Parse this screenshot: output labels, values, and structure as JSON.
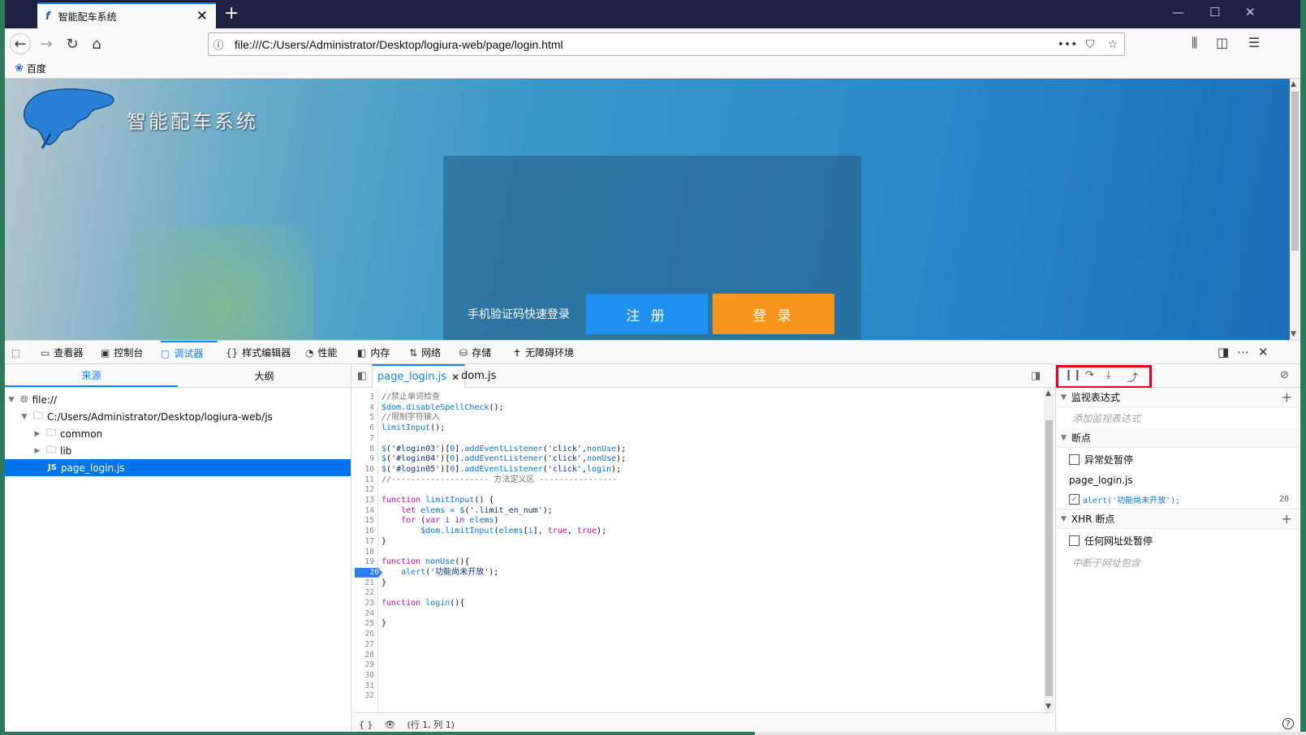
{
  "browser": {
    "tab_title": "智能配车系统",
    "tab_favicon": "f",
    "url": "file:///C:/Users/Administrator/Desktop/logiura-web/page/login.html",
    "bookmark": "百度",
    "more_icon": "•••"
  },
  "page": {
    "site_title": "智能配车系统",
    "sms_login": "手机验证码快速登录",
    "register_label": "注 册",
    "login_label": "登 录"
  },
  "devtools": {
    "tabs": [
      {
        "label": "查看器",
        "icon": "inspector-icon"
      },
      {
        "label": "控制台",
        "icon": "console-icon"
      },
      {
        "label": "调试器",
        "icon": "debugger-icon"
      },
      {
        "label": "样式编辑器",
        "icon": "style-editor-icon"
      },
      {
        "label": "性能",
        "icon": "performance-icon"
      },
      {
        "label": "内存",
        "icon": "memory-icon"
      },
      {
        "label": "网络",
        "icon": "network-icon"
      },
      {
        "label": "存储",
        "icon": "storage-icon"
      },
      {
        "label": "无障碍环境",
        "icon": "accessibility-icon"
      }
    ],
    "active_tab": "调试器",
    "sources": {
      "tab_sources": "来源",
      "tab_outline": "大纲",
      "tree": [
        {
          "label": "file://",
          "icon": "globe-icon",
          "level": 0
        },
        {
          "label": "C:/Users/Administrator/Desktop/logiura-web/js",
          "icon": "folder-icon",
          "level": 1
        },
        {
          "label": "common",
          "icon": "folder-icon",
          "level": 2
        },
        {
          "label": "lib",
          "icon": "folder-icon",
          "level": 2
        },
        {
          "label": "page_login.js",
          "icon": "js-file-icon",
          "level": 3
        }
      ]
    },
    "editor": {
      "tabs": [
        "page_login.js",
        "dom.js"
      ],
      "active_file": "page_login.js",
      "breakpoint_line": 20,
      "footer_pretty": "{ }",
      "footer_pos": "(行 1, 列 1)",
      "lines": [
        {
          "n": 3,
          "t": "//禁止单词检查"
        },
        {
          "n": 4,
          "t": "$dom.disableSpellCheck();"
        },
        {
          "n": 5,
          "t": "//限制字符输入"
        },
        {
          "n": 6,
          "t": "limitInput();"
        },
        {
          "n": 7,
          "t": ""
        },
        {
          "n": 8,
          "t": "$('#login03')[0].addEventListener('click',nonUse);"
        },
        {
          "n": 9,
          "t": "$('#login04')[0].addEventListener('click',nonUse);"
        },
        {
          "n": 10,
          "t": "$('#login05')[0].addEventListener('click',login);"
        },
        {
          "n": 11,
          "t": "//-------------------- 方法定义区 ----------------"
        },
        {
          "n": 12,
          "t": ""
        },
        {
          "n": 13,
          "t": "function limitInput() {"
        },
        {
          "n": 14,
          "t": "    let elems = $('.limit_en_num');"
        },
        {
          "n": 15,
          "t": "    for (var i in elems)"
        },
        {
          "n": 16,
          "t": "        $dom.limitInput(elems[i], true, true);"
        },
        {
          "n": 17,
          "t": "}"
        },
        {
          "n": 18,
          "t": ""
        },
        {
          "n": 19,
          "t": "function nonUse(){"
        },
        {
          "n": 20,
          "t": "    alert('功能尚未开放');"
        },
        {
          "n": 21,
          "t": "}"
        },
        {
          "n": 22,
          "t": ""
        },
        {
          "n": 23,
          "t": "function login(){"
        },
        {
          "n": 24,
          "t": ""
        },
        {
          "n": 25,
          "t": "}"
        },
        {
          "n": 26,
          "t": ""
        },
        {
          "n": 27,
          "t": ""
        },
        {
          "n": 28,
          "t": ""
        },
        {
          "n": 29,
          "t": ""
        },
        {
          "n": 30,
          "t": ""
        },
        {
          "n": 31,
          "t": ""
        },
        {
          "n": 32,
          "t": ""
        }
      ]
    },
    "right": {
      "watch_title": "监视表达式",
      "watch_placeholder": "添加监视表达式",
      "breakpoints_title": "断点",
      "pause_exceptions": "异常处暂停",
      "bp_file": "page_login.js",
      "bp_code": "alert('功能尚未开放');",
      "bp_line": "20",
      "xhr_title": "XHR 断点",
      "xhr_any": "任何网址处暂停",
      "xhr_placeholder": "中断于网址包含"
    }
  },
  "colors": {
    "accent": "#0a84ff",
    "titlebar": "#1f2143",
    "register_btn": "#1e90f0",
    "login_btn": "#f7941d",
    "highlight_box": "#e2001a"
  }
}
